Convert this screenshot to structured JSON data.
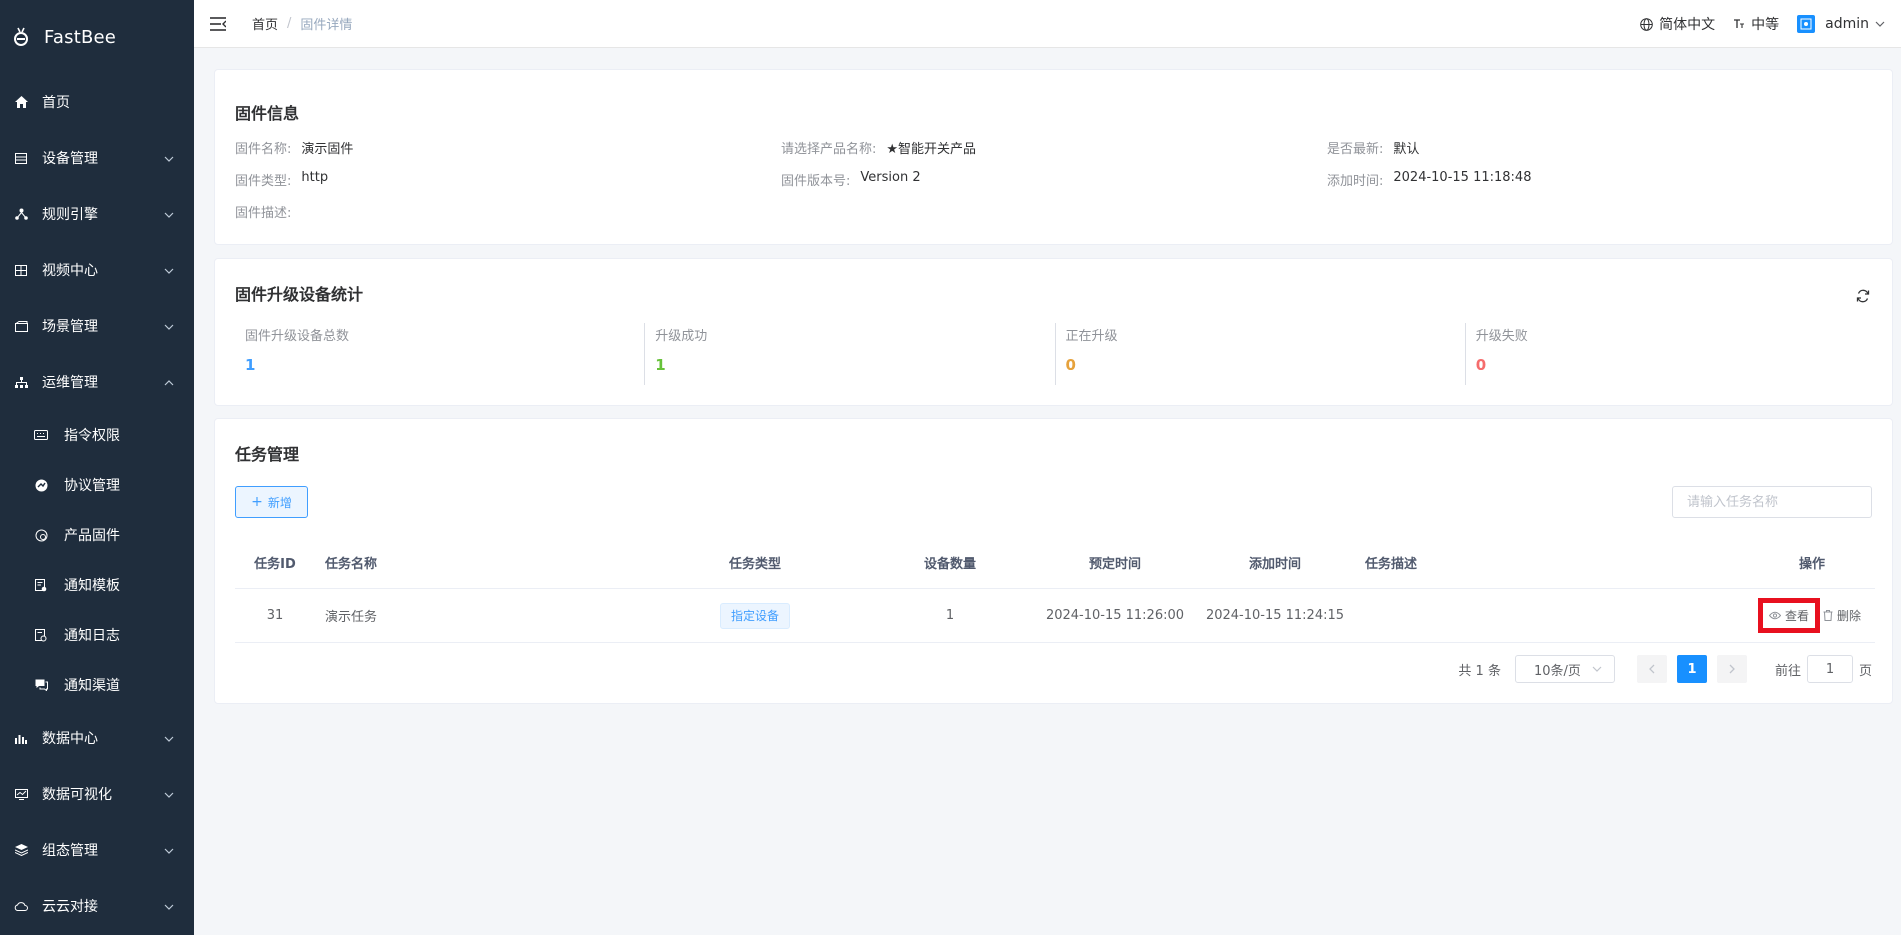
{
  "app": {
    "name": "FastBee"
  },
  "sidebar": {
    "items": [
      {
        "label": "首页",
        "icon": "home-icon"
      },
      {
        "label": "设备管理",
        "icon": "device-icon"
      },
      {
        "label": "规则引擎",
        "icon": "rule-icon"
      },
      {
        "label": "视频中心",
        "icon": "video-icon"
      },
      {
        "label": "场景管理",
        "icon": "scene-icon"
      },
      {
        "label": "运维管理",
        "icon": "ops-icon"
      },
      {
        "label": "数据中心",
        "icon": "data-icon"
      },
      {
        "label": "数据可视化",
        "icon": "visual-icon"
      },
      {
        "label": "组态管理",
        "icon": "layers-icon"
      },
      {
        "label": "云云对接",
        "icon": "cloud-icon"
      }
    ],
    "submenu": [
      {
        "label": "指令权限",
        "icon": "keyboard-icon"
      },
      {
        "label": "协议管理",
        "icon": "protocol-icon"
      },
      {
        "label": "产品固件",
        "icon": "firmware-icon"
      },
      {
        "label": "通知模板",
        "icon": "template-icon"
      },
      {
        "label": "通知日志",
        "icon": "log-icon"
      },
      {
        "label": "通知渠道",
        "icon": "channel-icon"
      }
    ]
  },
  "header": {
    "breadcrumb_home": "首页",
    "breadcrumb_sep": "/",
    "breadcrumb_current": "固件详情",
    "language": "简体中文",
    "font_size": "中等",
    "user": "admin"
  },
  "firmware_info": {
    "title": "固件信息",
    "name_label": "固件名称:",
    "name_value": "演示固件",
    "product_label": "请选择产品名称:",
    "product_value": "★智能开关产品",
    "latest_label": "是否最新:",
    "latest_value": "默认",
    "type_label": "固件类型:",
    "type_value": "http",
    "version_label": "固件版本号:",
    "version_value": "Version 2",
    "created_label": "添加时间:",
    "created_value": "2024-10-15 11:18:48",
    "desc_label": "固件描述:",
    "desc_value": ""
  },
  "stats": {
    "title": "固件升级设备统计",
    "items": [
      {
        "label": "固件升级设备总数",
        "value": "1",
        "color": "#409eff"
      },
      {
        "label": "升级成功",
        "value": "1",
        "color": "#67c23a"
      },
      {
        "label": "正在升级",
        "value": "0",
        "color": "#e6a23c"
      },
      {
        "label": "升级失败",
        "value": "0",
        "color": "#f56c6c"
      }
    ]
  },
  "tasks": {
    "title": "任务管理",
    "add_label": "新增",
    "search_placeholder": "请输入任务名称",
    "columns": [
      "任务ID",
      "任务名称",
      "任务类型",
      "设备数量",
      "预定时间",
      "添加时间",
      "任务描述",
      "操作"
    ],
    "rows": [
      {
        "id": "31",
        "name": "演示任务",
        "type": "指定设备",
        "device_count": "1",
        "scheduled": "2024-10-15 11:26:00",
        "created": "2024-10-15 11:24:15",
        "desc": "",
        "view_label": "查看",
        "delete_label": "删除"
      }
    ],
    "pagination": {
      "total": "共 1 条",
      "page_size": "10条/页",
      "current_page": "1",
      "goto_label": "前往",
      "goto_value": "1",
      "page_suffix": "页"
    }
  }
}
